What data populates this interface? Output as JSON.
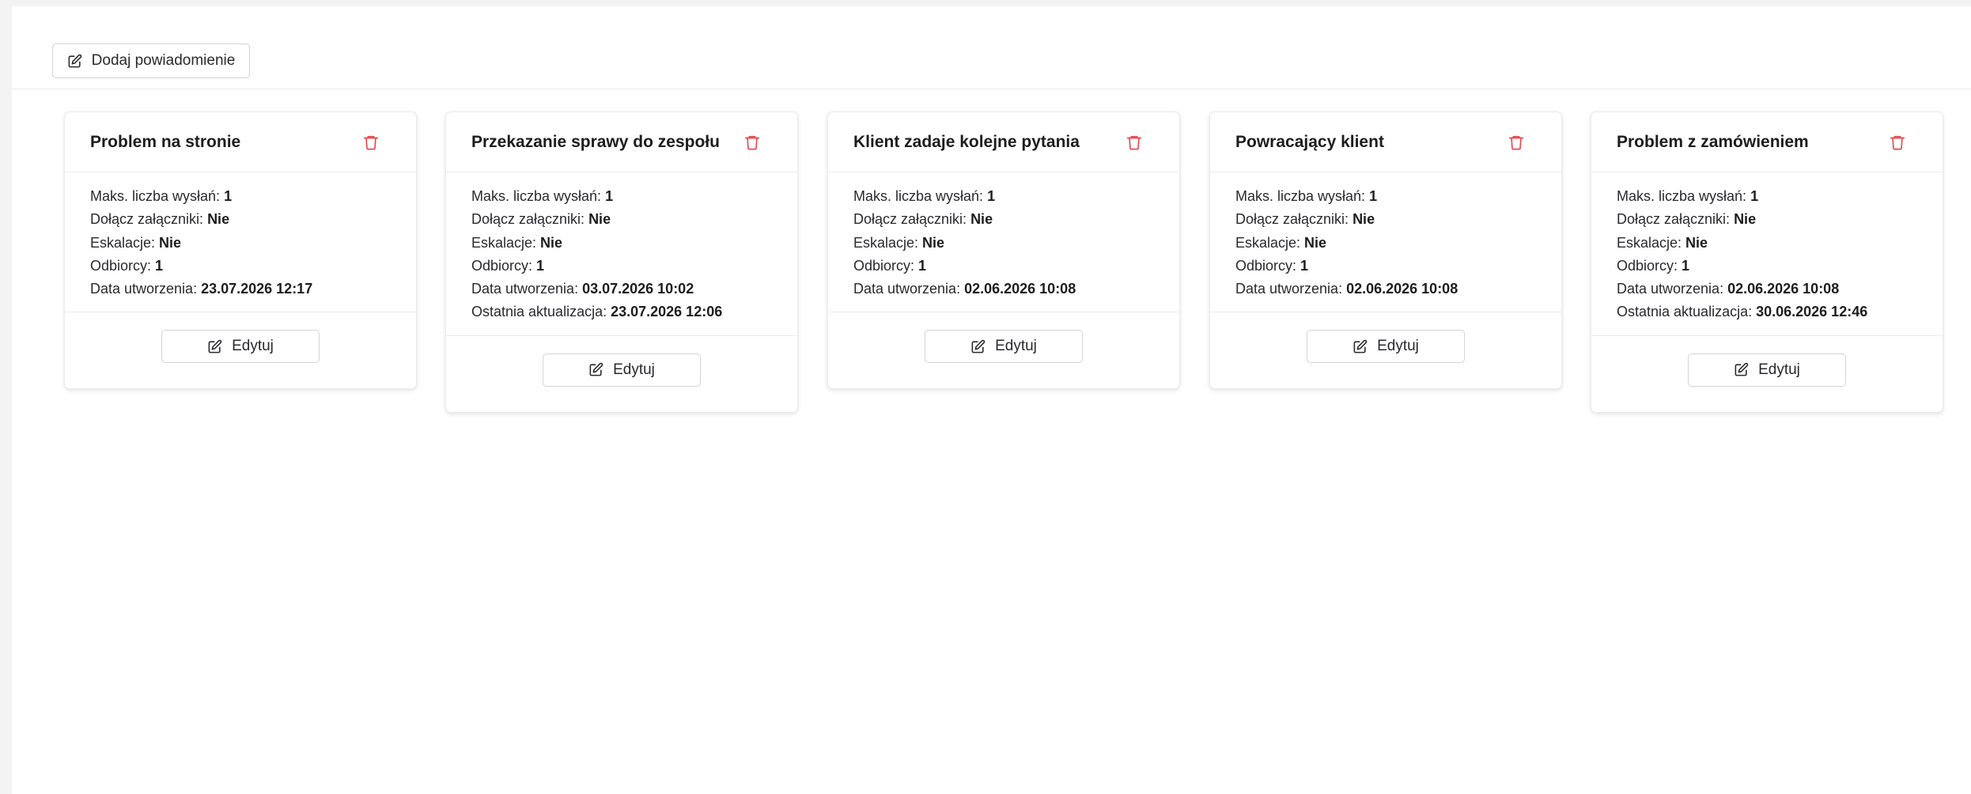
{
  "toolbar": {
    "add_button_label": "Dodaj powiadomienie"
  },
  "labels": {
    "max_sends": "Maks. liczba wysłań:",
    "attachments": "Dołącz załączniki:",
    "escalations": "Eskalacje:",
    "recipients": "Odbiorcy:",
    "created": "Data utworzenia:",
    "updated": "Ostatnia aktualizacja:",
    "edit_button": "Edytuj"
  },
  "icons": {
    "add": "edit-icon",
    "edit": "edit-icon",
    "delete": "trash-icon"
  },
  "colors": {
    "delete_icon": "#e5484d",
    "text": "#1d1d1f",
    "border": "#d4d4d8"
  },
  "cards": [
    {
      "title": "Problem na stronie",
      "max_sends": "1",
      "attachments": "Nie",
      "escalations": "Nie",
      "recipients": "1",
      "created": "23.07.2026 12:17",
      "updated": null
    },
    {
      "title": "Przekazanie sprawy do zespołu",
      "max_sends": "1",
      "attachments": "Nie",
      "escalations": "Nie",
      "recipients": "1",
      "created": "03.07.2026 10:02",
      "updated": "23.07.2026 12:06"
    },
    {
      "title": "Klient zadaje kolejne pytania",
      "max_sends": "1",
      "attachments": "Nie",
      "escalations": "Nie",
      "recipients": "1",
      "created": "02.06.2026 10:08",
      "updated": null
    },
    {
      "title": "Powracający klient",
      "max_sends": "1",
      "attachments": "Nie",
      "escalations": "Nie",
      "recipients": "1",
      "created": "02.06.2026 10:08",
      "updated": null
    },
    {
      "title": "Problem z zamówieniem",
      "max_sends": "1",
      "attachments": "Nie",
      "escalations": "Nie",
      "recipients": "1",
      "created": "02.06.2026 10:08",
      "updated": "30.06.2026 12:46"
    }
  ]
}
